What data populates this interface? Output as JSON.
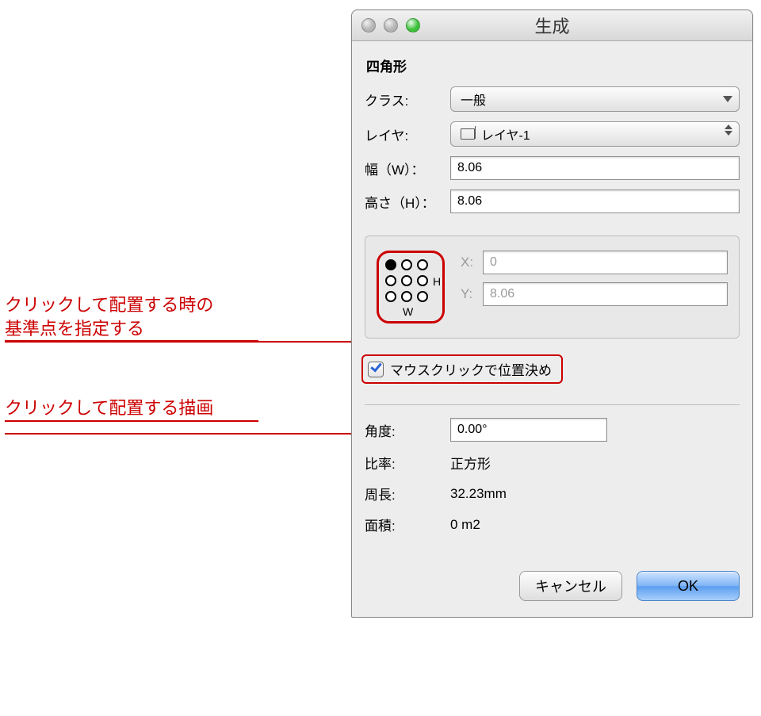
{
  "window": {
    "title": "生成"
  },
  "section_title": "四角形",
  "labels": {
    "class": "クラス:",
    "layer": "レイヤ:",
    "width": "幅（W）：",
    "height": "高さ（H）：",
    "x": "X:",
    "y": "Y:",
    "angle": "角度:",
    "ratio": "比率:",
    "perimeter": "周長:",
    "area": "面積:"
  },
  "values": {
    "class_selected": "一般",
    "layer_selected": "レイヤ-1",
    "width": "8.06",
    "height": "8.06",
    "x": "0",
    "y": "8.06",
    "angle": "0.00°",
    "ratio": "正方形",
    "perimeter": "32.23mm",
    "area": "0 m2"
  },
  "anchor": {
    "selected_index": 0,
    "h_label": "H",
    "w_label": "W"
  },
  "checkbox": {
    "mouse_click_label": "マウスクリックで位置決め",
    "checked": true
  },
  "buttons": {
    "cancel": "キャンセル",
    "ok": "OK"
  },
  "annotations": {
    "anno1_line1": "クリックして配置する時の",
    "anno1_line2": "基準点を指定する",
    "anno2": "クリックして配置する描画"
  }
}
